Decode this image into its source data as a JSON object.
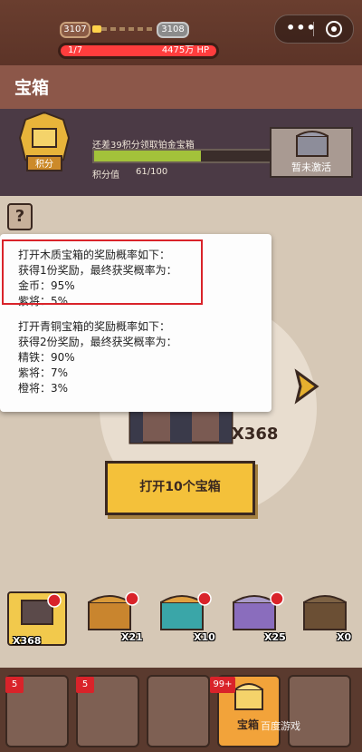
{
  "hud": {
    "stage_current": "3107",
    "stage_next": "3108",
    "wave": "1/7",
    "hp": "4475万 HP"
  },
  "title": "宝箱",
  "points": {
    "badge_text": "积分",
    "hint": "还差39积分领取铂金宝箱",
    "label": "积分值",
    "value": "61/100",
    "progress_fraction": 0.61,
    "locked_label": "暂未激活"
  },
  "tooltip": {
    "lines": [
      "打开木质宝箱的奖励概率如下：",
      "获得1份奖励，最终获奖概率为：",
      "金币：95%",
      "紫将：5%",
      "打开青铜宝箱的奖励概率如下：",
      "获得2份奖励，最终获奖概率为：",
      "精铁：90%",
      "紫将：7%",
      "橙将：3%"
    ]
  },
  "help_label": "?",
  "chest_count": "X368",
  "open_button": "打开10个宝箱",
  "chests": [
    {
      "name": "wooden",
      "count": "X368",
      "color": "#7a4a2a"
    },
    {
      "name": "bronze",
      "count": "X21",
      "color": "#c9852e"
    },
    {
      "name": "silver",
      "count": "X10",
      "color": "#3aa6a8"
    },
    {
      "name": "gold",
      "count": "X25",
      "color": "#8a6dbd"
    },
    {
      "name": "platinum",
      "count": "X0",
      "color": "#6b4f34"
    }
  ],
  "nav": {
    "badge_1": "5",
    "badge_2": "5",
    "badge_4": "99+",
    "chest_label": "宝箱",
    "watermark": "百度游戏"
  }
}
